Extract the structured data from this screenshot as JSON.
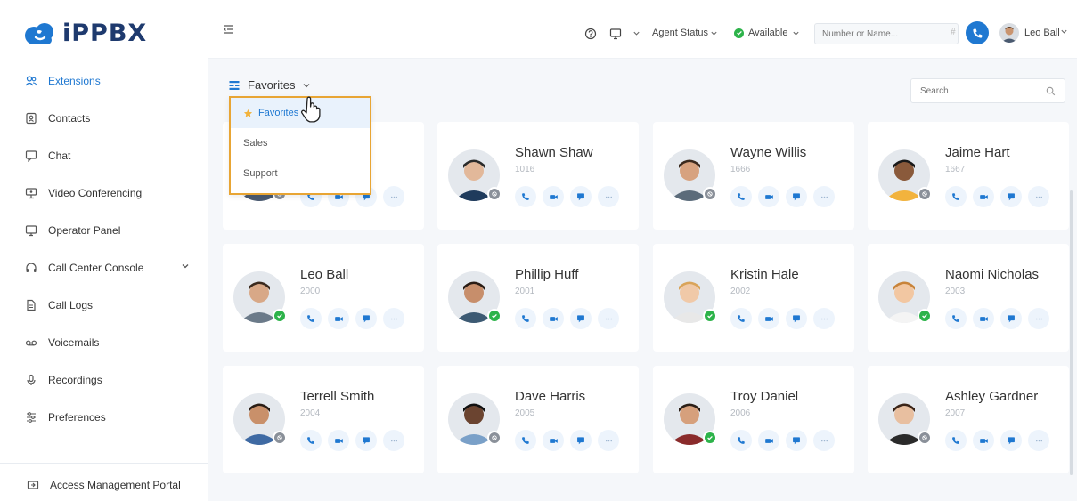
{
  "brand": {
    "name": "iPPBX"
  },
  "colors": {
    "accent": "#1f78d1",
    "available": "#2db34a",
    "highlight": "#e8a534"
  },
  "sidebar": {
    "items": [
      {
        "label": "Extensions",
        "icon": "users-icon"
      },
      {
        "label": "Contacts",
        "icon": "contacts-icon"
      },
      {
        "label": "Chat",
        "icon": "chat-icon"
      },
      {
        "label": "Video Conferencing",
        "icon": "video-icon"
      },
      {
        "label": "Operator Panel",
        "icon": "monitor-icon"
      },
      {
        "label": "Call Center Console",
        "icon": "headset-icon"
      },
      {
        "label": "Call Logs",
        "icon": "document-icon"
      },
      {
        "label": "Voicemails",
        "icon": "voicemail-icon"
      },
      {
        "label": "Recordings",
        "icon": "microphone-icon"
      },
      {
        "label": "Preferences",
        "icon": "sliders-icon"
      }
    ],
    "footer": "Access Management Portal"
  },
  "topbar": {
    "agent_status": "Agent Status",
    "availability": "Available",
    "number_placeholder": "Number or Name...",
    "hash": "#",
    "user": "Leo Ball"
  },
  "main": {
    "group": "Favorites",
    "search_placeholder": "Search",
    "dropdown": [
      "Favorites",
      "Sales",
      "Support"
    ],
    "action_icons": [
      "phone-icon",
      "video-icon",
      "chat-icon",
      "more-icon"
    ],
    "contacts": [
      {
        "name": "",
        "ext": "",
        "status": "offline"
      },
      {
        "name": "Shawn Shaw",
        "ext": "1016",
        "status": "offline"
      },
      {
        "name": "Wayne Willis",
        "ext": "1666",
        "status": "offline"
      },
      {
        "name": "Jaime Hart",
        "ext": "1667",
        "status": "offline"
      },
      {
        "name": "Leo Ball",
        "ext": "2000",
        "status": "available"
      },
      {
        "name": "Phillip Huff",
        "ext": "2001",
        "status": "available"
      },
      {
        "name": "Kristin Hale",
        "ext": "2002",
        "status": "available"
      },
      {
        "name": "Naomi Nicholas",
        "ext": "2003",
        "status": "available"
      },
      {
        "name": "Terrell Smith",
        "ext": "2004",
        "status": "offline"
      },
      {
        "name": "Dave Harris",
        "ext": "2005",
        "status": "offline"
      },
      {
        "name": "Troy Daniel",
        "ext": "2006",
        "status": "available"
      },
      {
        "name": "Ashley Gardner",
        "ext": "2007",
        "status": "offline"
      }
    ]
  }
}
